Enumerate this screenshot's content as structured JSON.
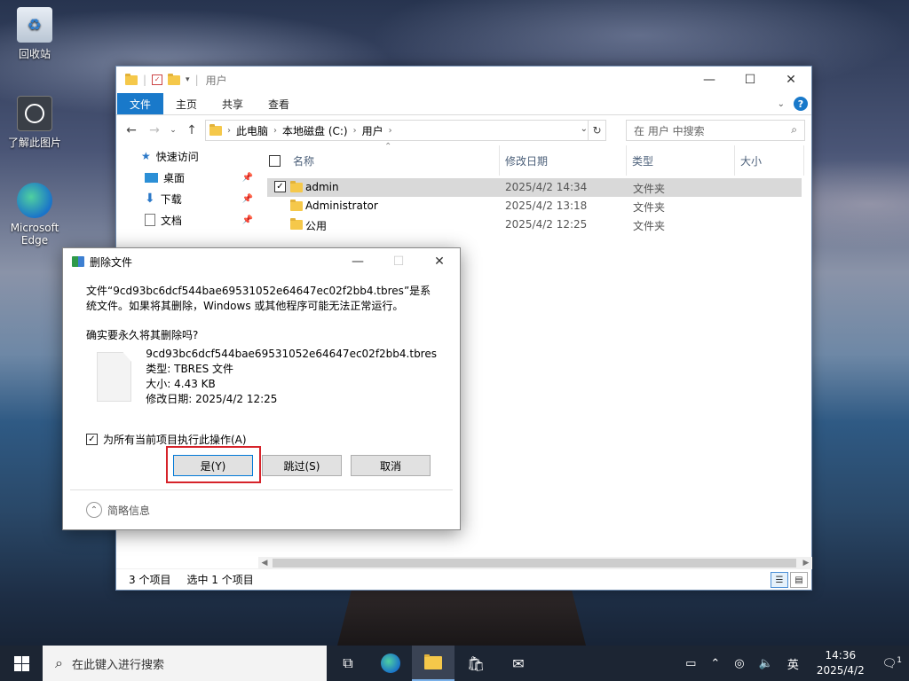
{
  "desktop": {
    "icons": [
      {
        "label": "回收站",
        "glyph": "recycle-bin"
      },
      {
        "label": "了解此图片",
        "glyph": "camera"
      },
      {
        "label": "Microsoft Edge",
        "glyph": "edge"
      }
    ]
  },
  "explorer": {
    "title": "用户",
    "ribbon_tabs": [
      "文件",
      "主页",
      "共享",
      "查看"
    ],
    "breadcrumb": [
      "此电脑",
      "本地磁盘 (C:)",
      "用户"
    ],
    "search_placeholder": "在 用户 中搜索",
    "nav": {
      "quick_access": "快速访问",
      "items": [
        "桌面",
        "下载",
        "文档"
      ]
    },
    "columns": {
      "name": "名称",
      "modified": "修改日期",
      "type": "类型",
      "size": "大小"
    },
    "rows": [
      {
        "name": "admin",
        "modified": "2025/4/2 14:34",
        "type": "文件夹",
        "selected": true
      },
      {
        "name": "Administrator",
        "modified": "2025/4/2 13:18",
        "type": "文件夹",
        "selected": false
      },
      {
        "name": "公用",
        "modified": "2025/4/2 12:25",
        "type": "文件夹",
        "selected": false
      }
    ],
    "status": {
      "count": "3 个项目",
      "selected": "选中 1 个项目"
    }
  },
  "dialog": {
    "title": "删除文件",
    "message": "文件“9cd93bc6dcf544bae69531052e64647ec02f2bb4.tbres”是系统文件。如果将其删除，Windows 或其他程序可能无法正常运行。",
    "question": "确实要永久将其删除吗?",
    "file_name": "9cd93bc6dcf544bae69531052e64647ec02f2bb4.tbres",
    "file_type": "类型: TBRES 文件",
    "file_size": "大小: 4.43 KB",
    "file_modified": "修改日期: 2025/4/2 12:25",
    "apply_all": "为所有当前项目执行此操作(A)",
    "apply_all_checked": true,
    "yes": "是(Y)",
    "skip": "跳过(S)",
    "cancel": "取消",
    "details": "简略信息"
  },
  "taskbar": {
    "search_placeholder": "在此键入进行搜索",
    "ime": "英",
    "time": "14:36",
    "date": "2025/4/2",
    "notification_count": "1"
  },
  "colors": {
    "accent": "#1979ca",
    "highlight_box": "#d6232a",
    "taskbar": "#1c2533"
  }
}
